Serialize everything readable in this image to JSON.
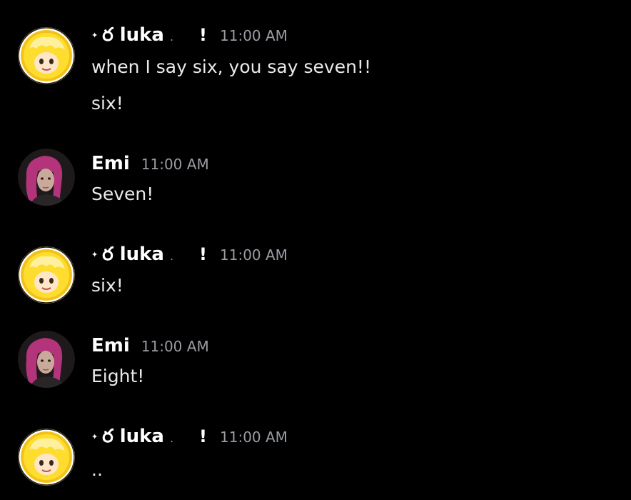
{
  "users": {
    "luka": {
      "prefix_glyph": "✦",
      "display_name": "ర luka",
      "trailing_dot": ".",
      "badge": "!",
      "avatar_icon": "blonde-anime-character-avatar",
      "avatar_colors": {
        "ring": "#f3c21a",
        "hair": "#ffdd2e",
        "skin": "#ffe6c8"
      }
    },
    "emi": {
      "display_name": "Emi",
      "avatar_icon": "purple-haired-person-avatar",
      "avatar_colors": {
        "hair": "#b3347a",
        "skin": "#c9a99a",
        "bg": "#1e1a1c"
      }
    }
  },
  "messages": [
    {
      "author": "luka",
      "timestamp": "11:00 AM",
      "lines": [
        "when I say six, you say seven!!",
        "six!"
      ]
    },
    {
      "author": "emi",
      "timestamp": "11:00 AM",
      "lines": [
        "Seven!"
      ]
    },
    {
      "author": "luka",
      "timestamp": "11:00 AM",
      "lines": [
        "six!"
      ]
    },
    {
      "author": "emi",
      "timestamp": "11:00 AM",
      "lines": [
        "Eight!"
      ]
    },
    {
      "author": "luka",
      "timestamp": "11:00 AM",
      "lines": [
        ".."
      ]
    }
  ]
}
